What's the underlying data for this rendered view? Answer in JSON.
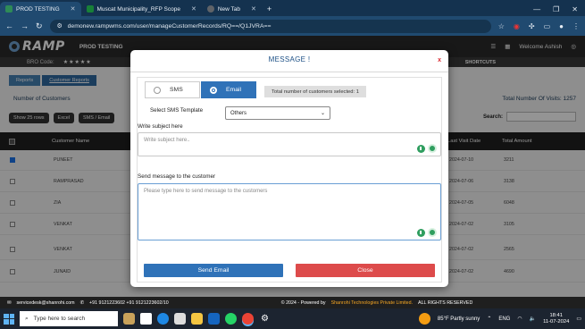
{
  "browser": {
    "tabs": [
      {
        "label": "PROD TESTING",
        "color": "#2e8b57"
      },
      {
        "label": "Muscat Municipality_RFP Scope",
        "color": "#188038"
      },
      {
        "label": "New Tab",
        "color": "#5f6368"
      }
    ],
    "url": "demonew.rampwms.com/user/manageCustomerRecords/RQ==/Q1JVRA=="
  },
  "app": {
    "logo": "RAMP",
    "logo_tagline": "REIMAGINING, REDEFINING",
    "instance": "PROD TESTING",
    "welcome": "Welcome Ashish",
    "bro_code_label": "BRO Code:",
    "stars": "★★★★★",
    "shortcuts": "SHORTCUTS"
  },
  "page": {
    "breadcrumb": [
      "Reports",
      "Customer Reports"
    ],
    "number_of_customers": "Number of Customers",
    "total_visits": "Total Number Of Visits: 1257",
    "buttons": [
      "Show 25 rows",
      "Excel",
      "SMS / Email"
    ],
    "search_label": "Search:",
    "columns": {
      "name": "Customer Name",
      "last_visit": "Last Visit Date",
      "total": "Total Amount"
    },
    "rows": [
      {
        "name": "PUNEET",
        "date": "2024-07-10",
        "total": "3211",
        "checked": true
      },
      {
        "name": "RAMPRASAD",
        "date": "2024-07-06",
        "total": "3138",
        "checked": false
      },
      {
        "name": "ZIA",
        "date": "2024-07-05",
        "total": "6048",
        "checked": false
      },
      {
        "name": "VENKAT",
        "date": "2024-07-02",
        "total": "3105",
        "checked": false
      },
      {
        "name": "VENKAT",
        "date": "2024-07-02",
        "total": "2565",
        "checked": false
      },
      {
        "name": "JUNAID",
        "date": "2024-07-02",
        "total": "4690",
        "checked": false
      }
    ]
  },
  "modal": {
    "title": "MESSAGE !",
    "close_x": "x",
    "sms_label": "SMS",
    "email_label": "Email",
    "selected_count": "Total number of customers selected: 1",
    "template_label": "Select SMS Template",
    "template_value": "Others",
    "subject_label": "Write subject here",
    "subject_placeholder": "Write subject here..",
    "message_label": "Send message to the customer",
    "message_placeholder": "Please type here to send message to the customers",
    "send_button": "Send Email",
    "close_button": "Close"
  },
  "footer": {
    "email": "servicedesk@shanrohi.com",
    "phones": "+91 9121223602   +91 9121223602/10",
    "copyright": "© 2024 - Powered by",
    "company": "Shanrohi Technologies Private Limited.",
    "rights": "ALL RIGHTS RESERVED"
  },
  "taskbar": {
    "search_placeholder": "Type here to search",
    "weather": "85°F  Partly sunny",
    "lang": "ENG",
    "time": "18:41",
    "date": "11-07-2024"
  }
}
